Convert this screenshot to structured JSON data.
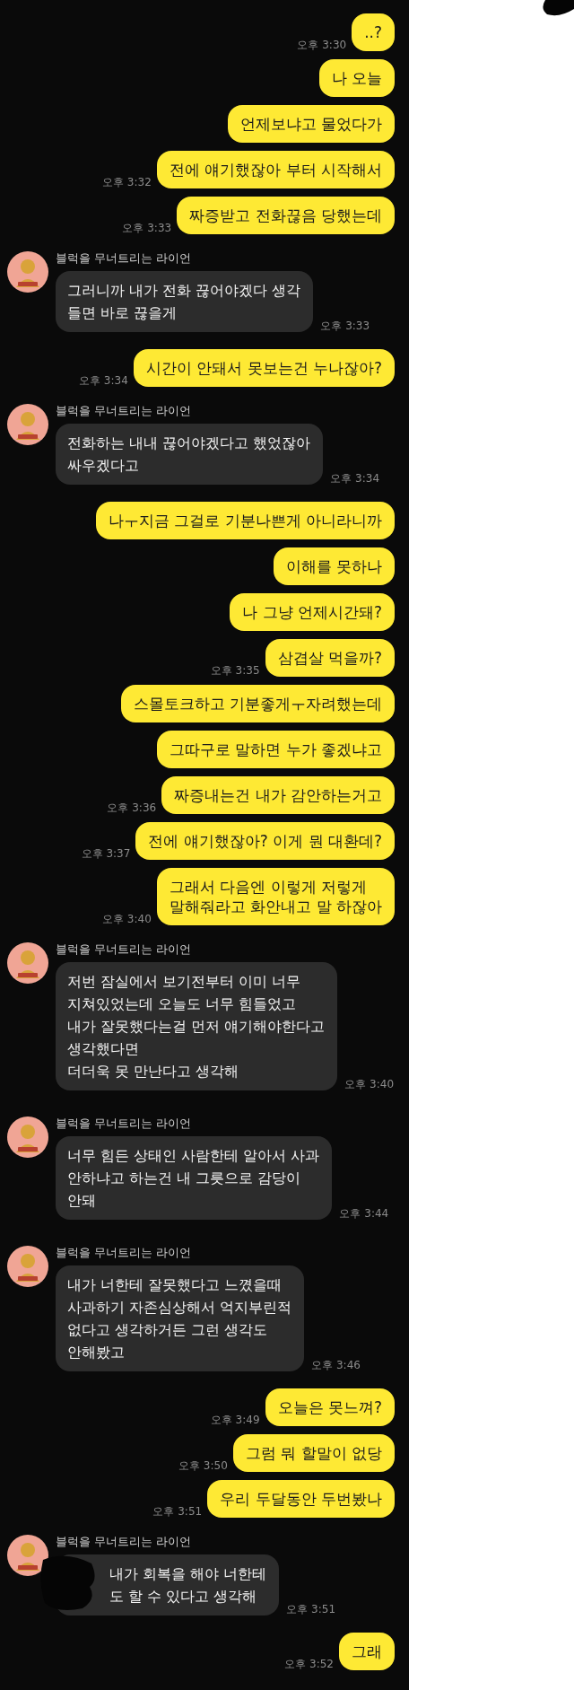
{
  "messages": [
    {
      "kind": "sent",
      "text": "..?",
      "time": "오후 3:30"
    },
    {
      "kind": "sent",
      "text": "나 오늘"
    },
    {
      "kind": "sent",
      "text": "언제보냐고 물었다가"
    },
    {
      "kind": "sent",
      "text": "전에 얘기했잖아 부터 시작해서",
      "time": "오후 3:32"
    },
    {
      "kind": "sent",
      "text": "짜증받고 전화끊음 당했는데",
      "time": "오후 3:33"
    },
    {
      "kind": "received",
      "sender": "블럭을 무너트리는 라이언",
      "text": "그러니까 내가 전화 끊어야겠다 생각\n들면 바로 끊을게",
      "time": "오후 3:33"
    },
    {
      "kind": "sent",
      "text": "시간이 안돼서 못보는건 누나잖아?",
      "time": "오후 3:34"
    },
    {
      "kind": "received",
      "sender": "블럭을 무너트리는 라이언",
      "text": "전화하는 내내 끊어야겠다고 했었잖아\n싸우겠다고",
      "time": "오후 3:34"
    },
    {
      "kind": "sent",
      "text": "나ㅜ지금 그걸로 기분나쁜게 아니라니까"
    },
    {
      "kind": "sent",
      "text": "이해를 못하나"
    },
    {
      "kind": "sent",
      "text": "나 그냥 언제시간돼?"
    },
    {
      "kind": "sent",
      "text": "삼겹살 먹을까?",
      "time": "오후 3:35"
    },
    {
      "kind": "sent",
      "text": "스몰토크하고 기분좋게ㅜ자려했는데"
    },
    {
      "kind": "sent",
      "text": "그따구로 말하면 누가 좋겠냐고"
    },
    {
      "kind": "sent",
      "text": "짜증내는건 내가 감안하는거고",
      "time": "오후 3:36"
    },
    {
      "kind": "sent",
      "text": "전에 얘기했잖아? 이게 뭔 대환데?",
      "time": "오후 3:37"
    },
    {
      "kind": "sent",
      "text": "그래서 다음엔 이렇게 저렇게\n말해줘라고 화안내고 말 하잖아",
      "time": "오후 3:40"
    },
    {
      "kind": "received",
      "sender": "블럭을 무너트리는 라이언",
      "text": "저번 잠실에서 보기전부터 이미 너무\n지쳐있었는데 오늘도 너무 힘들었고\n내가 잘못했다는걸 먼저 얘기해야한다고\n생각했다면\n더더욱 못 만난다고 생각해",
      "time": "오후 3:40"
    },
    {
      "kind": "received",
      "sender": "블럭을 무너트리는 라이언",
      "text": "너무 힘든 상태인 사람한테 알아서 사과\n안하냐고 하는건 내 그릇으로 감당이\n안돼",
      "time": "오후 3:44"
    },
    {
      "kind": "received",
      "sender": "블럭을 무너트리는 라이언",
      "text": "내가 너한테 잘못했다고 느꼈을때\n사과하기 자존심상해서 억지부린적\n없다고 생각하거든 그런 생각도\n안해봤고",
      "time": "오후 3:46"
    },
    {
      "kind": "sent",
      "text": "오늘은 못느껴?",
      "time": "오후 3:49"
    },
    {
      "kind": "sent",
      "text": "그럼 뭐 할말이 없당",
      "time": "오후 3:50"
    },
    {
      "kind": "sent",
      "text": "우리 두달동안 두번봤나",
      "time": "오후 3:51"
    },
    {
      "kind": "received",
      "sender": "블럭을 무너트리는 라이언",
      "text": "내가 회복을 해야 너한테\n도 할 수 있다고 생각해",
      "time": "오후 3:51",
      "redacted": true
    },
    {
      "kind": "sent",
      "text": "그래",
      "time": "오후 3:52"
    }
  ]
}
